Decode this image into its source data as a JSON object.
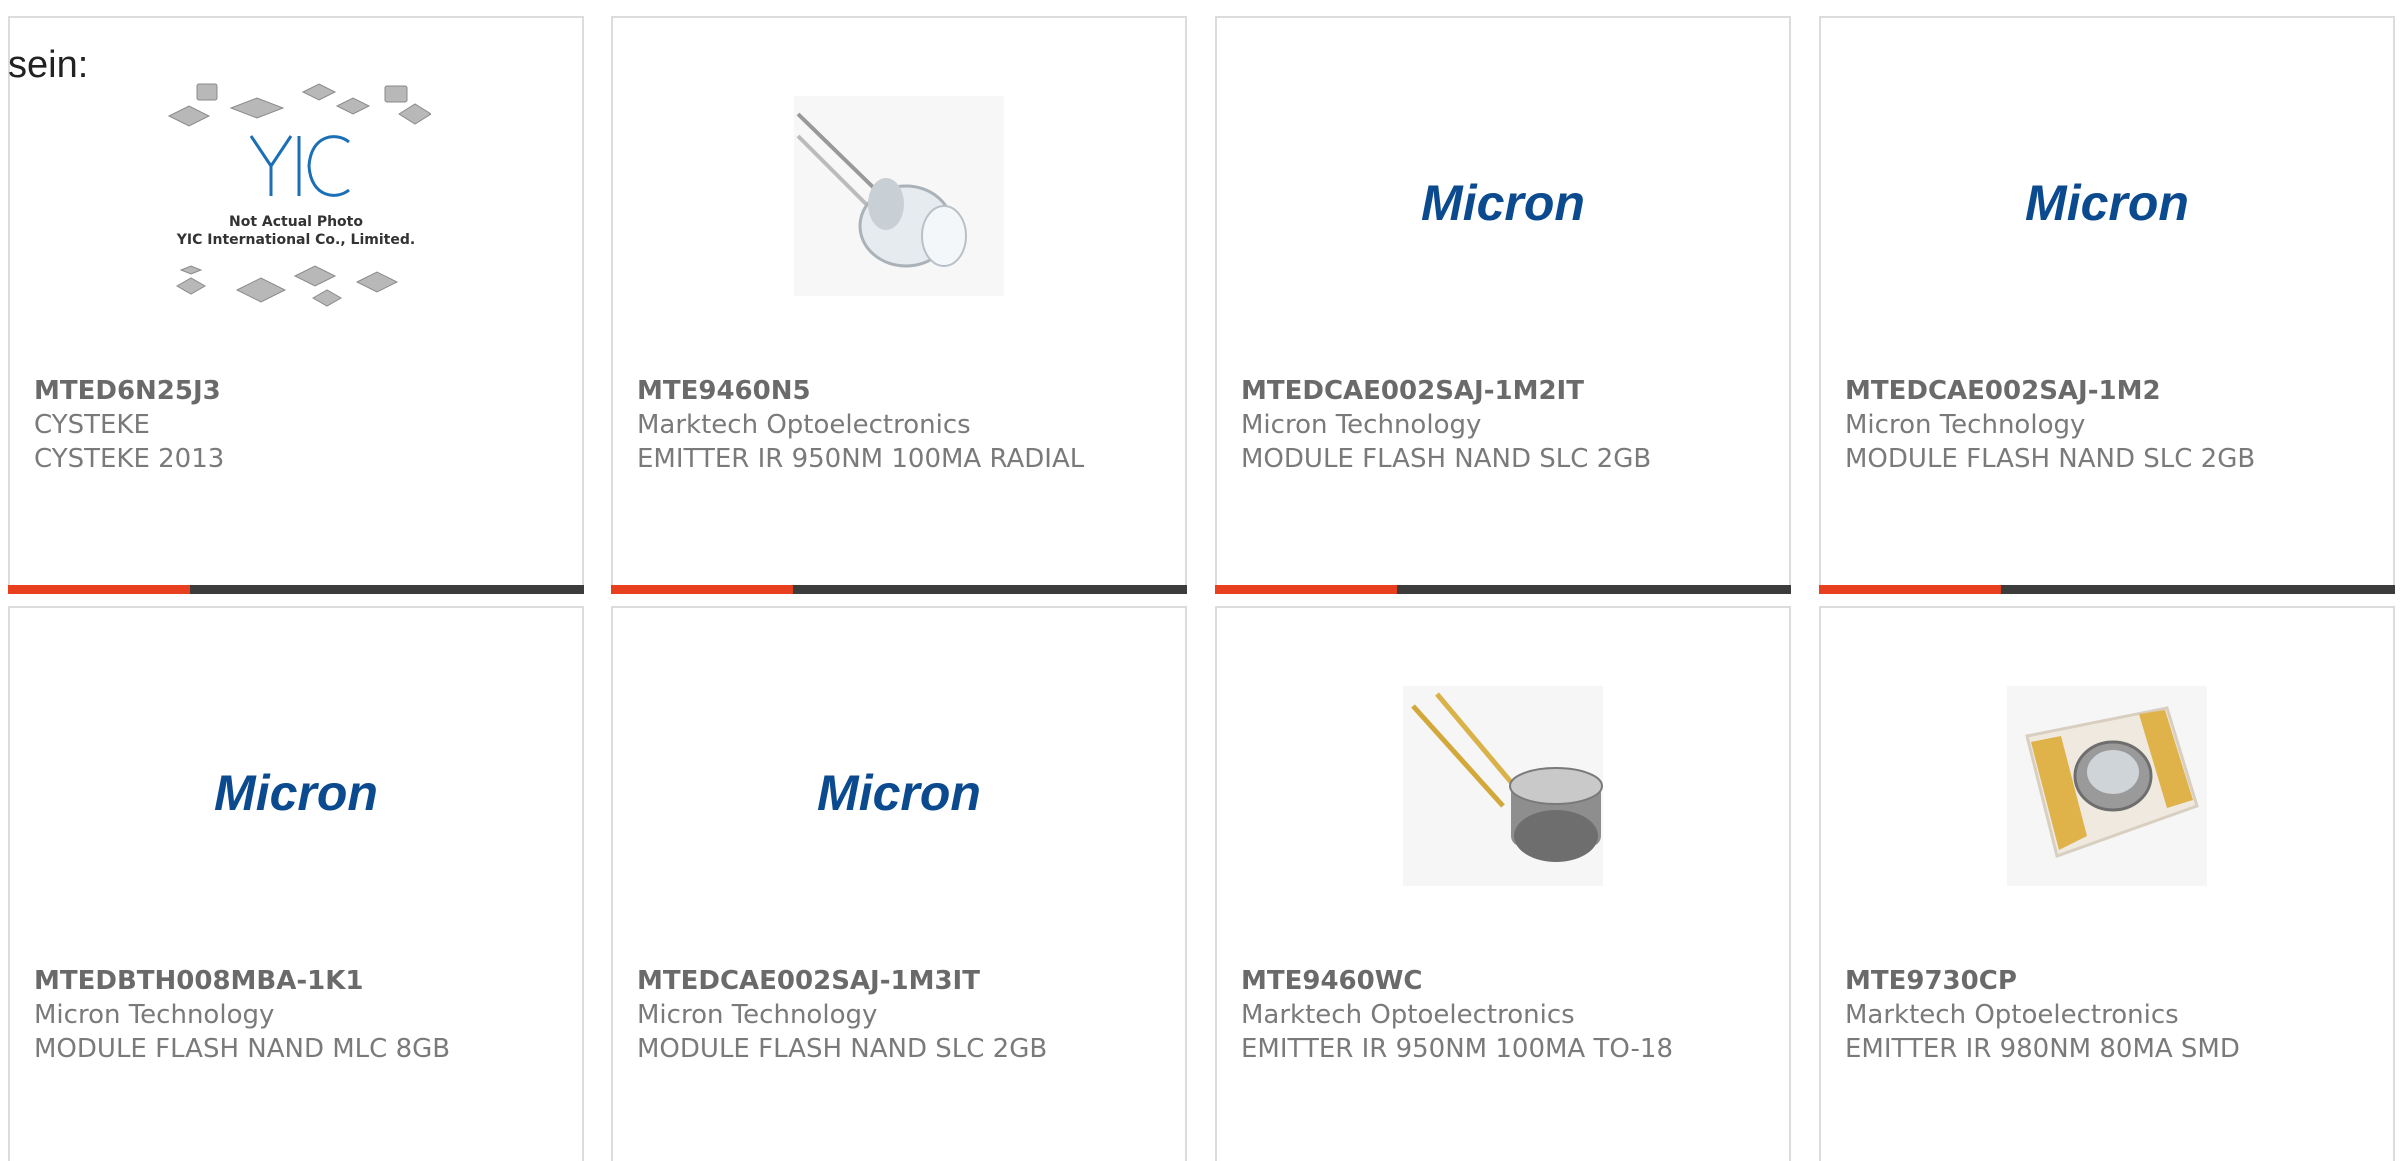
{
  "intro_text": "sein:",
  "colors": {
    "accent": "#e8401e",
    "bar_dark": "#3c3c3c",
    "micron_blue": "#0b4a8e"
  },
  "placeholder": {
    "line1": "Not Actual Photo",
    "line2": "YIC International Co., Limited.",
    "logo": "YIC"
  },
  "micron_logo_text": "Micron",
  "cards": [
    {
      "part": "MTED6N25J3",
      "manufacturer": "CYSTEKE",
      "description": "CYSTEKE 2013",
      "image": "yic-placeholder-photo"
    },
    {
      "part": "MTE9460N5",
      "manufacturer": "Marktech Optoelectronics",
      "description": "EMITTER IR 950NM 100MA RADIAL",
      "image": "led-radial-photo"
    },
    {
      "part": "MTEDCAE002SAJ-1M2IT",
      "manufacturer": "Micron Technology",
      "description": "MODULE FLASH NAND SLC 2GB",
      "image": "micron-logo"
    },
    {
      "part": "MTEDCAE002SAJ-1M2",
      "manufacturer": "Micron Technology",
      "description": "MODULE FLASH NAND SLC 2GB",
      "image": "micron-logo"
    },
    {
      "part": "MTEDBTH008MBA-1K1",
      "manufacturer": "Micron Technology",
      "description": "MODULE FLASH NAND MLC 8GB",
      "image": "micron-logo"
    },
    {
      "part": "MTEDCAE002SAJ-1M3IT",
      "manufacturer": "Micron Technology",
      "description": "MODULE FLASH NAND SLC 2GB",
      "image": "micron-logo"
    },
    {
      "part": "MTE9460WC",
      "manufacturer": "Marktech Optoelectronics",
      "description": "EMITTER IR 950NM 100MA TO-18",
      "image": "to18-can-photo"
    },
    {
      "part": "MTE9730CP",
      "manufacturer": "Marktech Optoelectronics",
      "description": "EMITTER IR 980NM 80MA SMD",
      "image": "smd-emitter-photo"
    }
  ]
}
